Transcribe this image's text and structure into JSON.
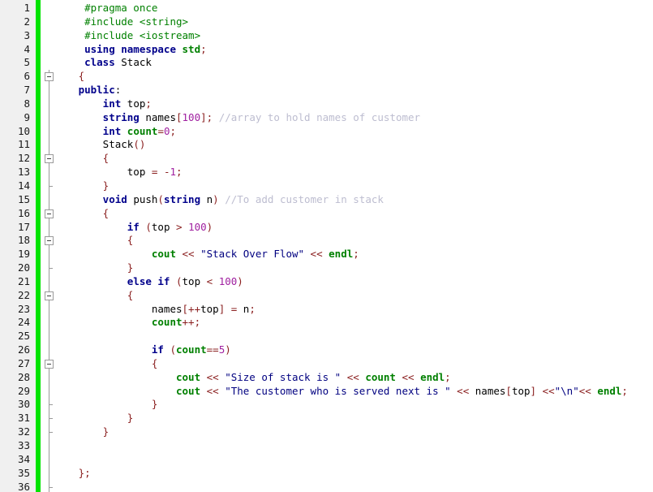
{
  "editor": {
    "language": "cpp",
    "filename_hint": "Stack class header",
    "total_lines_visible": 36,
    "colors": {
      "gutter_bg": "#f0f0f0",
      "change_bar": "#00e400",
      "editor_bg": "#ffffff",
      "preprocessor": "#008000",
      "keyword": "#00008b",
      "string": "#000080",
      "number": "#a020a0",
      "operator": "#8b2020",
      "comment": "#bdbdd0",
      "identifier_green": "#008000",
      "line_number": "#1a1a1a",
      "fold_line": "#9a9a9a"
    }
  },
  "gutter": {
    "line_numbers": [
      "1",
      "2",
      "3",
      "4",
      "5",
      "6",
      "7",
      "8",
      "9",
      "10",
      "11",
      "12",
      "13",
      "14",
      "15",
      "16",
      "17",
      "18",
      "19",
      "20",
      "21",
      "22",
      "23",
      "24",
      "25",
      "26",
      "27",
      "28",
      "29",
      "30",
      "31",
      "32",
      "33",
      "34",
      "35",
      "36"
    ]
  },
  "fold_margin": {
    "collapse_boxes_at_lines": [
      6,
      12,
      16,
      18,
      22,
      27
    ],
    "end_ticks_at_lines": [
      14,
      20,
      30,
      31,
      32,
      36
    ],
    "trunk_from_line": 6,
    "trunk_to_line": 36
  },
  "code": {
    "lines": [
      {
        "n": 1,
        "tokens": [
          {
            "c": "t-pre",
            "t": "    #pragma once"
          }
        ]
      },
      {
        "n": 2,
        "tokens": [
          {
            "c": "t-pre",
            "t": "    #include <string>"
          }
        ]
      },
      {
        "n": 3,
        "tokens": [
          {
            "c": "t-pre",
            "t": "    #include <iostream>"
          }
        ]
      },
      {
        "n": 4,
        "tokens": [
          {
            "c": "t-kw",
            "t": "    using namespace "
          },
          {
            "c": "t-grn",
            "t": "std"
          },
          {
            "c": "t-op",
            "t": ";"
          }
        ]
      },
      {
        "n": 5,
        "tokens": [
          {
            "c": "t-kw",
            "t": "    class "
          },
          {
            "c": "t-id",
            "t": "Stack"
          }
        ]
      },
      {
        "n": 6,
        "tokens": [
          {
            "c": "t-br",
            "t": "   {"
          }
        ]
      },
      {
        "n": 7,
        "tokens": [
          {
            "c": "t-kw",
            "t": "   public"
          },
          {
            "c": "t-pun",
            "t": ":"
          }
        ]
      },
      {
        "n": 8,
        "tokens": [
          {
            "c": "t-kw",
            "t": "       int "
          },
          {
            "c": "t-id",
            "t": "top"
          },
          {
            "c": "t-op",
            "t": ";"
          }
        ]
      },
      {
        "n": 9,
        "tokens": [
          {
            "c": "t-kw",
            "t": "       string "
          },
          {
            "c": "t-id",
            "t": "names"
          },
          {
            "c": "t-br",
            "t": "["
          },
          {
            "c": "t-num",
            "t": "100"
          },
          {
            "c": "t-br",
            "t": "]"
          },
          {
            "c": "t-op",
            "t": ";"
          },
          {
            "c": "t-cmt",
            "t": " //array to hold names of customer"
          }
        ]
      },
      {
        "n": 10,
        "tokens": [
          {
            "c": "t-kw",
            "t": "       int "
          },
          {
            "c": "t-grn",
            "t": "count"
          },
          {
            "c": "t-op",
            "t": "="
          },
          {
            "c": "t-num",
            "t": "0"
          },
          {
            "c": "t-op",
            "t": ";"
          }
        ]
      },
      {
        "n": 11,
        "tokens": [
          {
            "c": "t-id",
            "t": "       Stack"
          },
          {
            "c": "t-br",
            "t": "()"
          }
        ]
      },
      {
        "n": 12,
        "tokens": [
          {
            "c": "t-br",
            "t": "       {"
          }
        ]
      },
      {
        "n": 13,
        "tokens": [
          {
            "c": "t-id",
            "t": "           top "
          },
          {
            "c": "t-op",
            "t": "= -"
          },
          {
            "c": "t-num",
            "t": "1"
          },
          {
            "c": "t-op",
            "t": ";"
          }
        ]
      },
      {
        "n": 14,
        "tokens": [
          {
            "c": "t-br",
            "t": "       }"
          }
        ]
      },
      {
        "n": 15,
        "tokens": [
          {
            "c": "t-kw",
            "t": "       void "
          },
          {
            "c": "t-id",
            "t": "push"
          },
          {
            "c": "t-br",
            "t": "("
          },
          {
            "c": "t-kw",
            "t": "string"
          },
          {
            "c": "t-id",
            "t": " n"
          },
          {
            "c": "t-br",
            "t": ")"
          },
          {
            "c": "t-cmt",
            "t": " //To add customer in stack"
          }
        ]
      },
      {
        "n": 16,
        "tokens": [
          {
            "c": "t-br",
            "t": "       {"
          }
        ]
      },
      {
        "n": 17,
        "tokens": [
          {
            "c": "t-kw",
            "t": "           if "
          },
          {
            "c": "t-br",
            "t": "("
          },
          {
            "c": "t-id",
            "t": "top "
          },
          {
            "c": "t-op",
            "t": "> "
          },
          {
            "c": "t-num",
            "t": "100"
          },
          {
            "c": "t-br",
            "t": ")"
          }
        ]
      },
      {
        "n": 18,
        "tokens": [
          {
            "c": "t-br",
            "t": "           {"
          }
        ]
      },
      {
        "n": 19,
        "tokens": [
          {
            "c": "t-grn",
            "t": "               cout "
          },
          {
            "c": "t-op",
            "t": "<< "
          },
          {
            "c": "t-str",
            "t": "\"Stack Over Flow\""
          },
          {
            "c": "t-op",
            "t": " << "
          },
          {
            "c": "t-grn",
            "t": "endl"
          },
          {
            "c": "t-op",
            "t": ";"
          }
        ]
      },
      {
        "n": 20,
        "tokens": [
          {
            "c": "t-br",
            "t": "           }"
          }
        ]
      },
      {
        "n": 21,
        "tokens": [
          {
            "c": "t-kw",
            "t": "           else if "
          },
          {
            "c": "t-br",
            "t": "("
          },
          {
            "c": "t-id",
            "t": "top "
          },
          {
            "c": "t-op",
            "t": "< "
          },
          {
            "c": "t-num",
            "t": "100"
          },
          {
            "c": "t-br",
            "t": ")"
          }
        ]
      },
      {
        "n": 22,
        "tokens": [
          {
            "c": "t-br",
            "t": "           {"
          }
        ]
      },
      {
        "n": 23,
        "tokens": [
          {
            "c": "t-id",
            "t": "               names"
          },
          {
            "c": "t-br",
            "t": "["
          },
          {
            "c": "t-op",
            "t": "++"
          },
          {
            "c": "t-id",
            "t": "top"
          },
          {
            "c": "t-br",
            "t": "]"
          },
          {
            "c": "t-op",
            "t": " = "
          },
          {
            "c": "t-id",
            "t": "n"
          },
          {
            "c": "t-op",
            "t": ";"
          }
        ]
      },
      {
        "n": 24,
        "tokens": [
          {
            "c": "t-grn",
            "t": "               count"
          },
          {
            "c": "t-op",
            "t": "++;"
          }
        ]
      },
      {
        "n": 25,
        "tokens": [
          {
            "c": "t-id",
            "t": ""
          }
        ]
      },
      {
        "n": 26,
        "tokens": [
          {
            "c": "t-kw",
            "t": "               if "
          },
          {
            "c": "t-br",
            "t": "("
          },
          {
            "c": "t-grn",
            "t": "count"
          },
          {
            "c": "t-op",
            "t": "=="
          },
          {
            "c": "t-num",
            "t": "5"
          },
          {
            "c": "t-br",
            "t": ")"
          }
        ]
      },
      {
        "n": 27,
        "tokens": [
          {
            "c": "t-br",
            "t": "               {"
          }
        ]
      },
      {
        "n": 28,
        "tokens": [
          {
            "c": "t-grn",
            "t": "                   cout "
          },
          {
            "c": "t-op",
            "t": "<< "
          },
          {
            "c": "t-str",
            "t": "\"Size of stack is \""
          },
          {
            "c": "t-op",
            "t": " << "
          },
          {
            "c": "t-grn",
            "t": "count"
          },
          {
            "c": "t-op",
            "t": " << "
          },
          {
            "c": "t-grn",
            "t": "endl"
          },
          {
            "c": "t-op",
            "t": ";"
          }
        ]
      },
      {
        "n": 29,
        "tokens": [
          {
            "c": "t-grn",
            "t": "                   cout "
          },
          {
            "c": "t-op",
            "t": "<< "
          },
          {
            "c": "t-str",
            "t": "\"The customer who is served next is \""
          },
          {
            "c": "t-op",
            "t": " << "
          },
          {
            "c": "t-id",
            "t": "names"
          },
          {
            "c": "t-br",
            "t": "["
          },
          {
            "c": "t-id",
            "t": "top"
          },
          {
            "c": "t-br",
            "t": "]"
          },
          {
            "c": "t-op",
            "t": " <<"
          },
          {
            "c": "t-str",
            "t": "\"\\n\""
          },
          {
            "c": "t-op",
            "t": "<< "
          },
          {
            "c": "t-grn",
            "t": "endl"
          },
          {
            "c": "t-op",
            "t": ";"
          }
        ]
      },
      {
        "n": 30,
        "tokens": [
          {
            "c": "t-br",
            "t": "               }"
          }
        ]
      },
      {
        "n": 31,
        "tokens": [
          {
            "c": "t-br",
            "t": "           }"
          }
        ]
      },
      {
        "n": 32,
        "tokens": [
          {
            "c": "t-br",
            "t": "       }"
          }
        ]
      },
      {
        "n": 33,
        "tokens": [
          {
            "c": "t-id",
            "t": ""
          }
        ]
      },
      {
        "n": 34,
        "tokens": [
          {
            "c": "t-id",
            "t": ""
          }
        ]
      },
      {
        "n": 35,
        "tokens": [
          {
            "c": "t-br",
            "t": "   }"
          },
          {
            "c": "t-op",
            "t": ";"
          }
        ]
      },
      {
        "n": 36,
        "tokens": [
          {
            "c": "t-id",
            "t": ""
          }
        ]
      }
    ]
  }
}
